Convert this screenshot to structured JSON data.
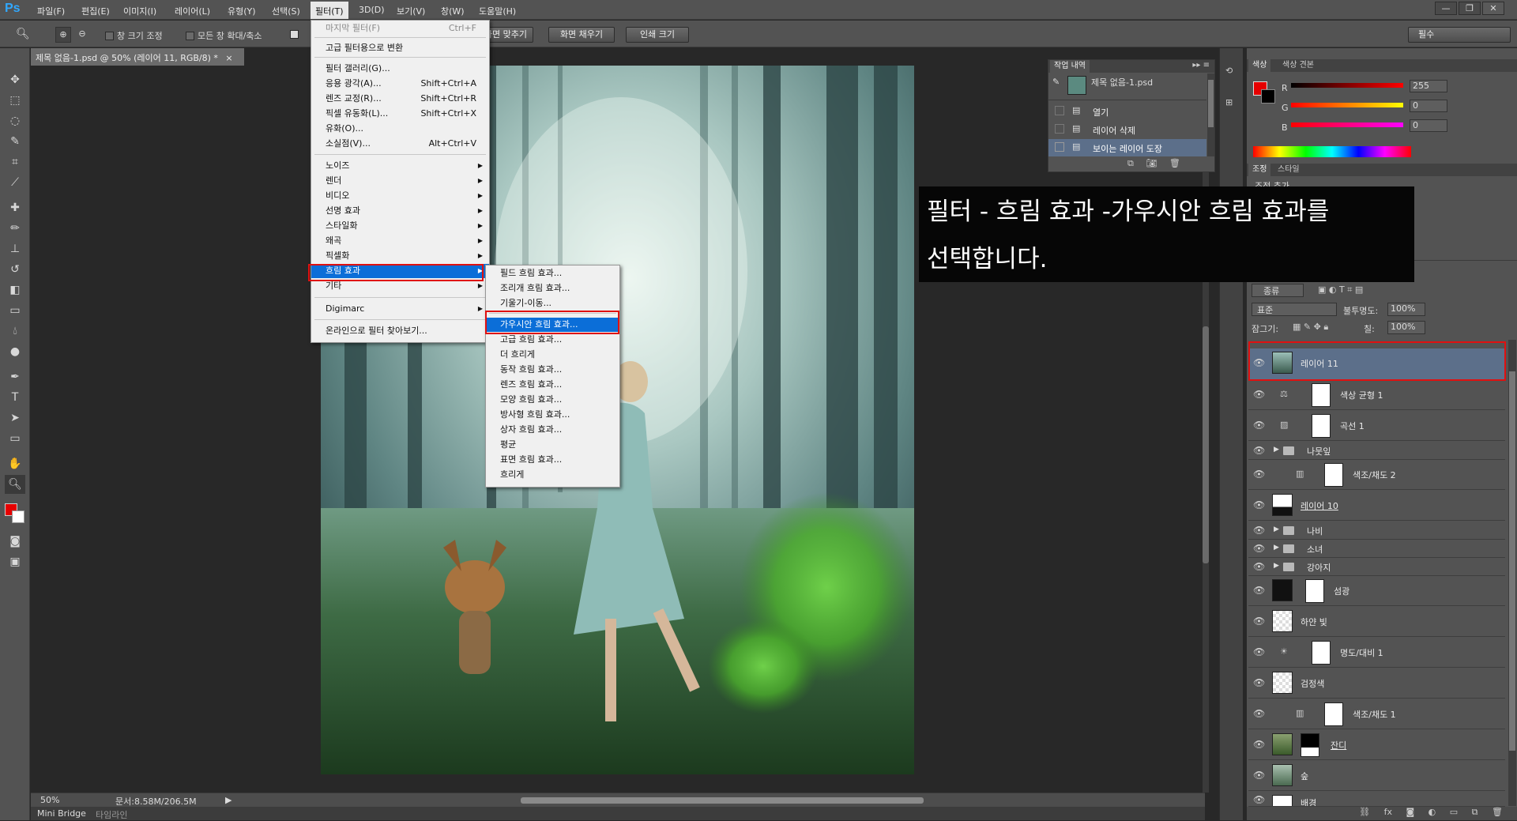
{
  "app": {
    "logo": "Ps"
  },
  "menubar": {
    "items": [
      "파일(F)",
      "편집(E)",
      "이미지(I)",
      "레이어(L)",
      "유형(Y)",
      "선택(S)",
      "필터(T)",
      "3D(D)",
      "보기(V)",
      "창(W)",
      "도움말(H)"
    ],
    "active": "필터(T)",
    "window_controls": [
      "—",
      "❐",
      "✕"
    ]
  },
  "options_bar": {
    "checkbox_resize": "창 크기 조정",
    "checkbox_all_windows": "모든 창 확대/축소",
    "btn_fit": "화면 맞추기",
    "btn_fill": "화면 채우기",
    "btn_print": "인쇄 크기",
    "workspace": "필수"
  },
  "document": {
    "tab_title": "제목 없음-1.psd @ 50% (레이어 11, RGB/8) *",
    "tab_close": "×"
  },
  "status": {
    "zoom": "50%",
    "doc_size": "문서:8.58M/206.5M"
  },
  "bottom_tabs": [
    "Mini Bridge",
    "타임라인"
  ],
  "filter_menu": {
    "last_filter": {
      "label": "마지막 필터(F)",
      "shortcut": "Ctrl+F"
    },
    "convert_smart": "고급 필터용으로 변환",
    "group1": [
      {
        "label": "필터 갤러리(G)...",
        "shortcut": ""
      },
      {
        "label": "응용 광각(A)...",
        "shortcut": "Shift+Ctrl+A"
      },
      {
        "label": "렌즈 교정(R)...",
        "shortcut": "Shift+Ctrl+R"
      },
      {
        "label": "픽셀 유동화(L)...",
        "shortcut": "Shift+Ctrl+X"
      },
      {
        "label": "유화(O)...",
        "shortcut": ""
      },
      {
        "label": "소실점(V)...",
        "shortcut": "Alt+Ctrl+V"
      }
    ],
    "submenus": [
      "노이즈",
      "렌더",
      "비디오",
      "선명 효과",
      "스타일화",
      "왜곡",
      "픽셀화",
      "흐림 효과",
      "기타"
    ],
    "highlighted": "흐림 효과",
    "digimarc": "Digimarc",
    "browse_online": "온라인으로 필터 찾아보기..."
  },
  "blur_submenu": {
    "items": [
      "필드 흐림 효과...",
      "조리개 흐림 효과...",
      "기울기-이동...",
      "가우시안 흐림 효과...",
      "고급 흐림 효과...",
      "더 흐리게",
      "동작 흐림 효과...",
      "렌즈 흐림 효과...",
      "모양 흐림 효과...",
      "방사형 흐림 효과...",
      "상자 흐림 효과...",
      "평균",
      "표면 흐림 효과...",
      "흐리게"
    ],
    "highlighted": "가우시안 흐림 효과..."
  },
  "history_panel": {
    "tab": "작업 내역",
    "snapshot": "제목 없음-1.psd",
    "states": [
      "열기",
      "레이어 삭제",
      "보이는 레이어 도장"
    ]
  },
  "color_panel": {
    "tabs": [
      "색상",
      "색상 견본"
    ],
    "r_label": "R",
    "g_label": "G",
    "b_label": "B",
    "r": "255",
    "g": "0",
    "b": "0",
    "foreground": "#e60000"
  },
  "adjust_panel": {
    "tabs": [
      "조정",
      "스타일"
    ],
    "sublabel": "조정 추가"
  },
  "layers_panel": {
    "filter_kind": "종류",
    "blend_mode": "표준",
    "opacity_label": "불투명도:",
    "opacity": "100%",
    "lock_label": "잠그기:",
    "fill_label": "칠:",
    "fill": "100%",
    "layers": [
      "레이어 11",
      "색상 균형 1",
      "곡선 1",
      "나뭇잎",
      "색조/채도 2",
      "레이어 10",
      "나비",
      "소녀",
      "강아지",
      "섬광",
      "하얀 빛",
      "명도/대비 1",
      "검정색",
      "색조/채도 1",
      "잔디",
      "숲",
      "배경"
    ]
  },
  "callout": {
    "text": "필터 - 흐림 효과 -가우시안 흐림 효과를\n선택합니다."
  }
}
